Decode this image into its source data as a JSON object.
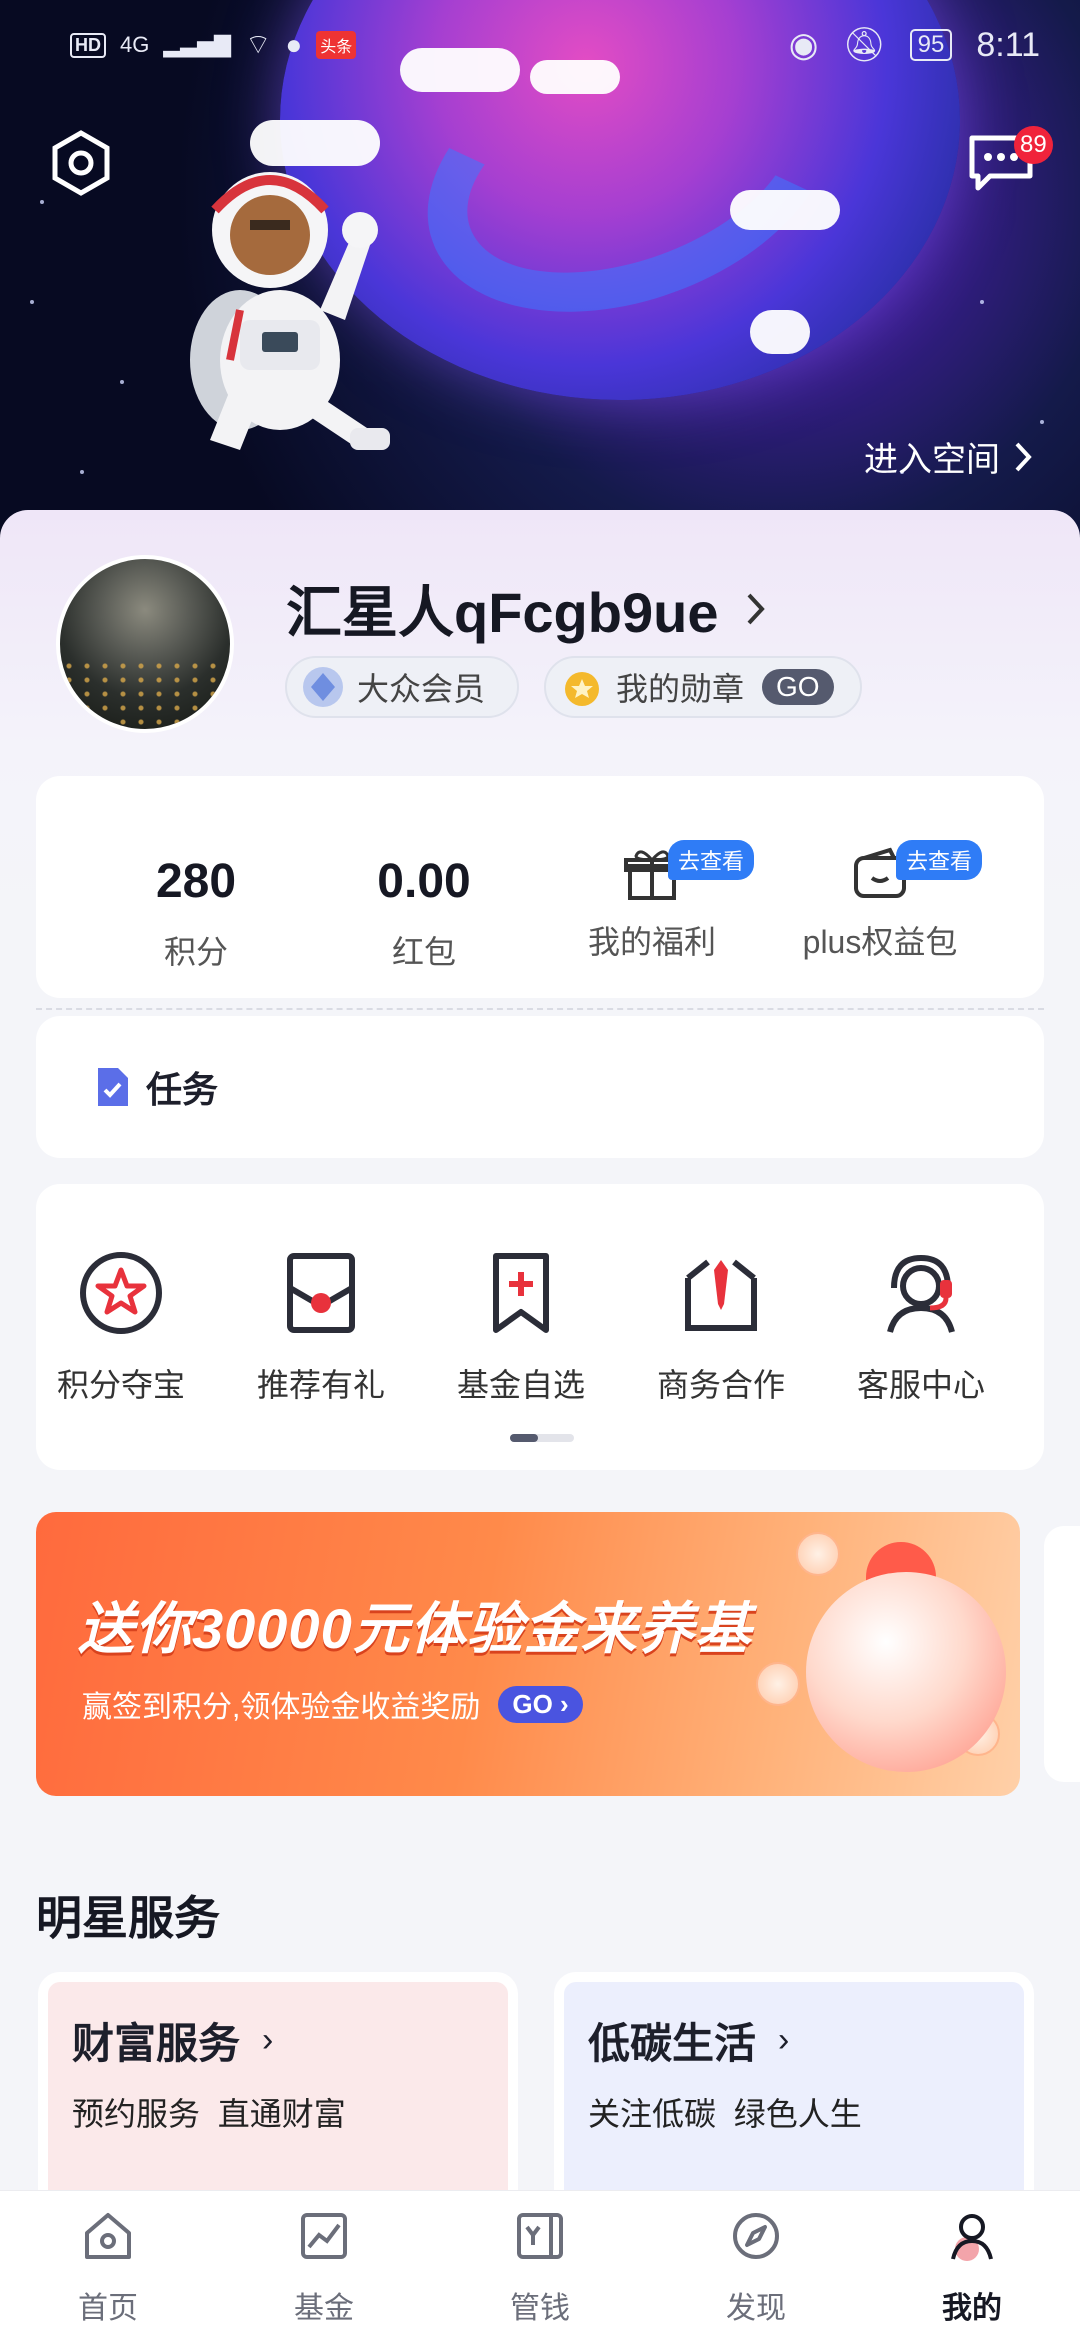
{
  "status_bar": {
    "left_tags": [
      "HD",
      "4G"
    ],
    "news_tag": "头条",
    "battery": "95",
    "time": "8:11"
  },
  "header": {
    "message_badge": "89",
    "enter_space": "进入空间"
  },
  "profile": {
    "username": "汇星人qFcgb9ue",
    "member_level": "大众会员",
    "medals": "我的勋章",
    "medals_go": "GO"
  },
  "stats": [
    {
      "value": "280",
      "label": "积分"
    },
    {
      "value": "0.00",
      "label": "红包"
    },
    {
      "label": "我的福利",
      "badge": "去查看",
      "icon": "gift-icon"
    },
    {
      "label": "plus权益包",
      "badge": "去查看",
      "icon": "wallet-icon"
    }
  ],
  "task": {
    "label": "任务"
  },
  "menu": [
    {
      "label": "积分夺宝",
      "icon": "star-circle-icon"
    },
    {
      "label": "推荐有礼",
      "icon": "envelope-icon"
    },
    {
      "label": "基金自选",
      "icon": "bookmark-plus-icon"
    },
    {
      "label": "商务合作",
      "icon": "tie-icon"
    },
    {
      "label": "客服中心",
      "icon": "headset-icon"
    }
  ],
  "banner": {
    "headline": "送你30000元体验金来养基",
    "sub": "赢签到积分,领体验金收益奖励",
    "go": "GO"
  },
  "star_services": {
    "title": "明星服务",
    "cards": [
      {
        "title": "财富服务",
        "subtitle": "预约服务  直通财富"
      },
      {
        "title": "低碳生活",
        "subtitle": "关注低碳  绿色人生"
      }
    ]
  },
  "tabbar": [
    {
      "label": "首页",
      "icon": "home-icon"
    },
    {
      "label": "基金",
      "icon": "trend-chart-icon"
    },
    {
      "label": "管钱",
      "icon": "ledger-icon"
    },
    {
      "label": "发现",
      "icon": "compass-icon"
    },
    {
      "label": "我的",
      "icon": "profile-icon",
      "active": true
    }
  ],
  "colors": {
    "accent_blue": "#2f7cf6",
    "badge_red": "#f0233b",
    "banner_orange": "#ff6a3d",
    "icon_red": "#e8323c"
  }
}
